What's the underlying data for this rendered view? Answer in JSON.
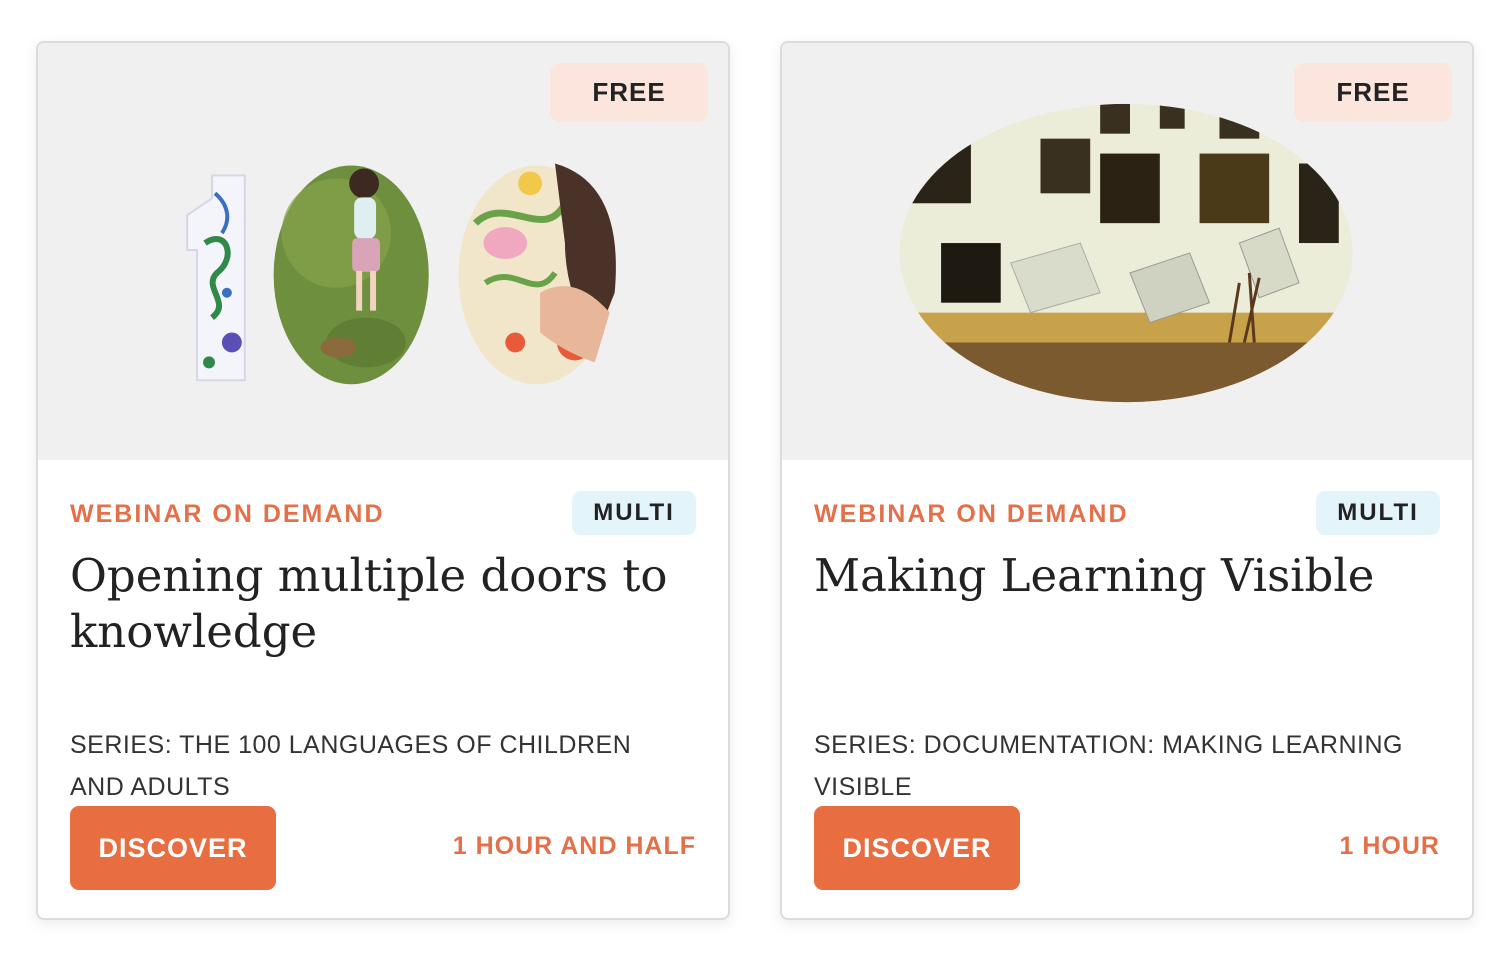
{
  "cards": [
    {
      "price_badge": "FREE",
      "category": "WEBINAR ON DEMAND",
      "language_badge": "MULTI",
      "title": "Opening multiple doors to knowledge",
      "series": "SERIES: THE 100 LANGUAGES OF CHILDREN AND ADULTS",
      "cta_label": "DISCOVER",
      "duration": "1 HOUR AND HALF",
      "image_icon": "number-100-photo-collage"
    },
    {
      "price_badge": "FREE",
      "category": "WEBINAR ON DEMAND",
      "language_badge": "MULTI",
      "title": "Making Learning Visible",
      "series": "SERIES: DOCUMENTATION: MAKING LEARNING VISIBLE",
      "cta_label": "DISCOVER",
      "duration": "1 HOUR",
      "image_icon": "oval-exhibition-photo"
    }
  ],
  "colors": {
    "accent": "#e86d40",
    "accent_text": "#e4704a",
    "free_badge_bg": "#fbe5dd",
    "lang_badge_bg": "#e3f5fb",
    "media_bg": "#f0f0f0"
  }
}
